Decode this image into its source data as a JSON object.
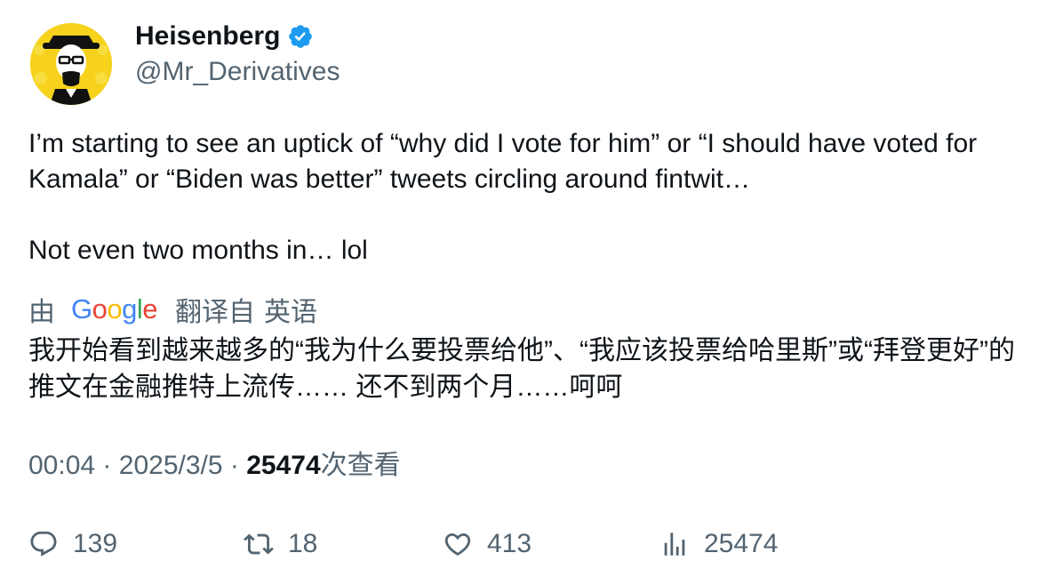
{
  "author": {
    "display_name": "Heisenberg",
    "handle": "@Mr_Derivatives",
    "verified": true,
    "verified_color": "#1d9bf0",
    "avatar_icon": "heisenberg-avatar"
  },
  "tweet": {
    "text": "I’m starting to see an uptick of “why did I vote for him” or “I should have voted for Kamala” or “Biden was better” tweets circling around fintwit…\n\nNot even two months in… lol"
  },
  "translation": {
    "by_label": "由",
    "provider": "Google",
    "from_label": "翻译自",
    "language": "英语",
    "text": "我开始看到越来越多的“我为什么要投票给他”、“我应该投票给哈里斯”或“拜登更好”的推文在金融推特上流传…… 还不到两个月……呵呵"
  },
  "meta": {
    "time": "00:04",
    "separator": "·",
    "date": "2025/3/5",
    "views_count": "25474",
    "views_label": "次查看"
  },
  "actions": {
    "replies": {
      "icon": "reply-icon",
      "count": "139"
    },
    "retweets": {
      "icon": "retweet-icon",
      "count": "18"
    },
    "likes": {
      "icon": "heart-icon",
      "count": "413"
    },
    "views": {
      "icon": "analytics-icon",
      "count": "25474"
    }
  }
}
